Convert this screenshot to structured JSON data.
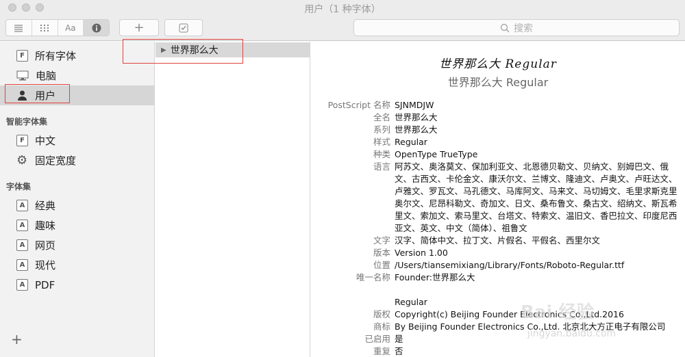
{
  "window": {
    "title": "用户（1 种字体）"
  },
  "toolbar": {
    "view_modes": [
      "list-view",
      "grid-view",
      "sample-view",
      "info-view"
    ],
    "sample_label": "Aa",
    "add_label": "+",
    "validate_label": "☑",
    "search_placeholder": "搜索"
  },
  "sidebar": {
    "library_items": [
      {
        "label": "所有字体",
        "icon": "font-file-icon"
      },
      {
        "label": "电脑",
        "icon": "computer-icon"
      },
      {
        "label": "用户",
        "icon": "user-icon",
        "selected": true
      }
    ],
    "smart_heading": "智能字体集",
    "smart_items": [
      {
        "label": "中文",
        "icon": "font-file-icon"
      },
      {
        "label": "固定宽度",
        "icon": "gear-icon"
      }
    ],
    "collections_heading": "字体集",
    "collection_items": [
      {
        "label": "经典",
        "icon": "collection-icon"
      },
      {
        "label": "趣味",
        "icon": "collection-icon"
      },
      {
        "label": "网页",
        "icon": "collection-icon"
      },
      {
        "label": "现代",
        "icon": "collection-icon"
      },
      {
        "label": "PDF",
        "icon": "collection-icon"
      }
    ],
    "add_label": "+"
  },
  "font_list": {
    "items": [
      {
        "label": "世界那么大"
      }
    ]
  },
  "preview": {
    "script_sample": "世界那么大 Regular",
    "font_name": "世界那么大 Regular"
  },
  "info": {
    "rows": [
      {
        "label": "PostScript 名称",
        "value": "SJNMDJW"
      },
      {
        "label": "全名",
        "value": "世界那么大"
      },
      {
        "label": "系列",
        "value": "世界那么大"
      },
      {
        "label": "样式",
        "value": "Regular"
      },
      {
        "label": "种类",
        "value": "OpenType TrueType"
      },
      {
        "label": "语言",
        "value": "阿苏文、奥洛莫文、保加利亚文、北恩德贝勒文、贝纳文、别姆巴文、俄文、古西文、卡伦金文、康沃尔文、兰博文、隆迪文、卢奥文、卢旺达文、卢雅文、罗瓦文、马孔德文、马库阿文、马来文、马切姆文、毛里求斯克里奥尔文、尼昂科勒文、奇加文、日文、桑布鲁文、桑古文、绍纳文、斯瓦希里文、索加文、索马里文、台塔文、特索文、温旧文、香巴拉文、印度尼西亚文、英文、中文（简体）、祖鲁文"
      },
      {
        "label": "文字",
        "value": "汉字、简体中文、拉丁文、片假名、平假名、西里尔文"
      },
      {
        "label": "版本",
        "value": "Version 1.00"
      },
      {
        "label": "位置",
        "value": "/Users/tiansemixiang/Library/Fonts/Roboto-Regular.ttf"
      },
      {
        "label": "唯一名称",
        "value": "Founder:世界那么大"
      },
      {
        "label": "",
        "value": ""
      },
      {
        "label": "",
        "value": "Regular"
      },
      {
        "label": "版权",
        "value": "Copyright(c) Beijing Founder Electronics Co.,Ltd.2016"
      },
      {
        "label": "商标",
        "value": "By Beijing Founder Electronics Co.,Ltd. 北京北大方正电子有限公司"
      },
      {
        "label": "已启用",
        "value": "是"
      },
      {
        "label": "重复",
        "value": "否"
      }
    ]
  },
  "watermark": {
    "main": "Bai 经验",
    "sub": "jingyan.baidu.com"
  },
  "colors": {
    "annotation_red": "#e0413f",
    "selection_gray": "#d6d6d6"
  }
}
